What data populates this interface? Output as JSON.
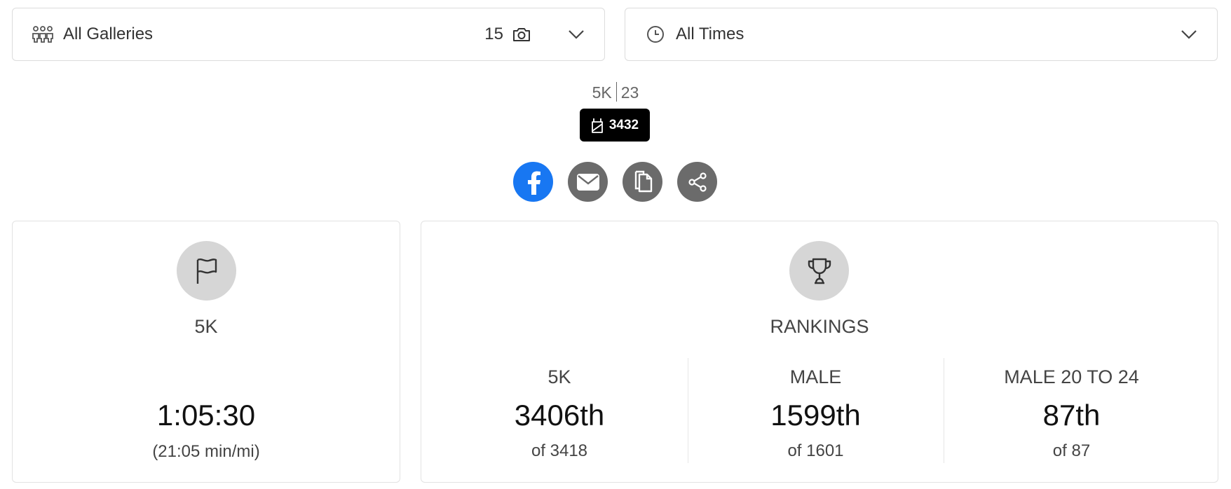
{
  "filters": {
    "galleries": {
      "label": "All Galleries",
      "count": "15",
      "icon": "people-group-icon"
    },
    "times": {
      "label": "All Times",
      "icon": "clock-icon"
    }
  },
  "participant": {
    "race": "5K",
    "age": "23",
    "bib": "3432"
  },
  "share": {
    "buttons": [
      "facebook-icon",
      "email-icon",
      "copy-icon",
      "share-icon"
    ],
    "colors": {
      "facebook": "#1877f2",
      "gray": "#6b6b6b"
    }
  },
  "time_card": {
    "race": "5K",
    "time": "1:05:30",
    "pace": "(21:05 min/mi)"
  },
  "rankings": {
    "title": "RANKINGS",
    "columns": [
      {
        "label": "5K",
        "place": "3406th",
        "of": "of 3418"
      },
      {
        "label": "MALE",
        "place": "1599th",
        "of": "of 1601"
      },
      {
        "label": "MALE 20 TO 24",
        "place": "87th",
        "of": "of 87"
      }
    ]
  }
}
